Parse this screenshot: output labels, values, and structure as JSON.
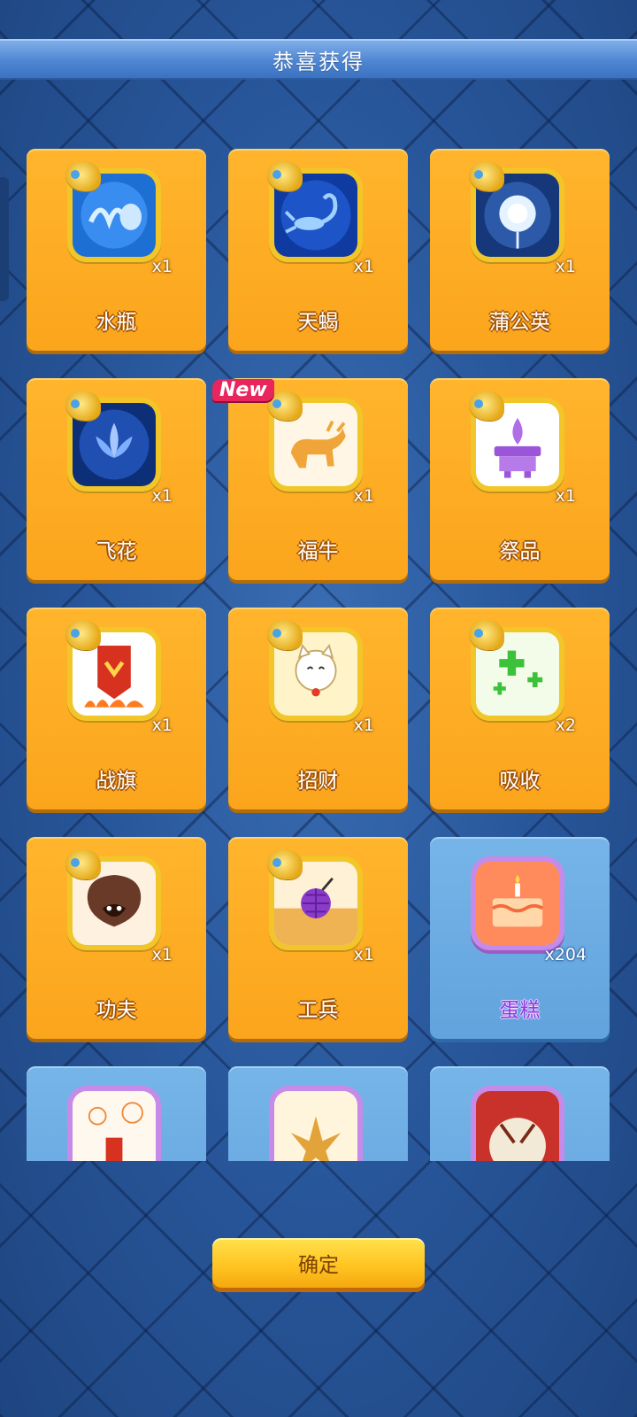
{
  "header": {
    "title": "恭喜获得"
  },
  "new_badge": "New",
  "items": [
    {
      "name": "水瓶",
      "qty": "x1",
      "rarity": "gold",
      "icon": "aquarius-vase-icon"
    },
    {
      "name": "天蝎",
      "qty": "x1",
      "rarity": "gold",
      "icon": "scorpion-icon"
    },
    {
      "name": "蒲公英",
      "qty": "x1",
      "rarity": "gold",
      "icon": "dandelion-icon"
    },
    {
      "name": "飞花",
      "qty": "x1",
      "rarity": "gold",
      "icon": "lotus-flower-icon"
    },
    {
      "name": "福牛",
      "qty": "x1",
      "rarity": "gold",
      "icon": "ox-icon",
      "is_new": true
    },
    {
      "name": "祭品",
      "qty": "x1",
      "rarity": "gold",
      "icon": "offering-altar-icon"
    },
    {
      "name": "战旗",
      "qty": "x1",
      "rarity": "gold",
      "icon": "war-banner-icon"
    },
    {
      "name": "招财",
      "qty": "x1",
      "rarity": "gold",
      "icon": "lucky-cat-icon"
    },
    {
      "name": "吸收",
      "qty": "x2",
      "rarity": "gold",
      "icon": "absorb-cross-icon"
    },
    {
      "name": "功夫",
      "qty": "x1",
      "rarity": "gold",
      "icon": "kungfu-mask-icon"
    },
    {
      "name": "工兵",
      "qty": "x1",
      "rarity": "gold",
      "icon": "grenade-icon"
    },
    {
      "name": "蛋糕",
      "qty": "x204",
      "rarity": "blue",
      "icon": "cake-icon"
    },
    {
      "name": "",
      "qty": "",
      "rarity": "blue",
      "icon": "firecracker-icon"
    },
    {
      "name": "",
      "qty": "",
      "rarity": "blue",
      "icon": "explosion-icon"
    },
    {
      "name": "",
      "qty": "",
      "rarity": "blue",
      "icon": "drum-icon"
    }
  ],
  "footer": {
    "confirm_label": "确定"
  },
  "colors": {
    "gold_card": "#fba51c",
    "blue_card": "#62a3dd",
    "background": "#24508f",
    "title_bar": "#4f86d2"
  }
}
